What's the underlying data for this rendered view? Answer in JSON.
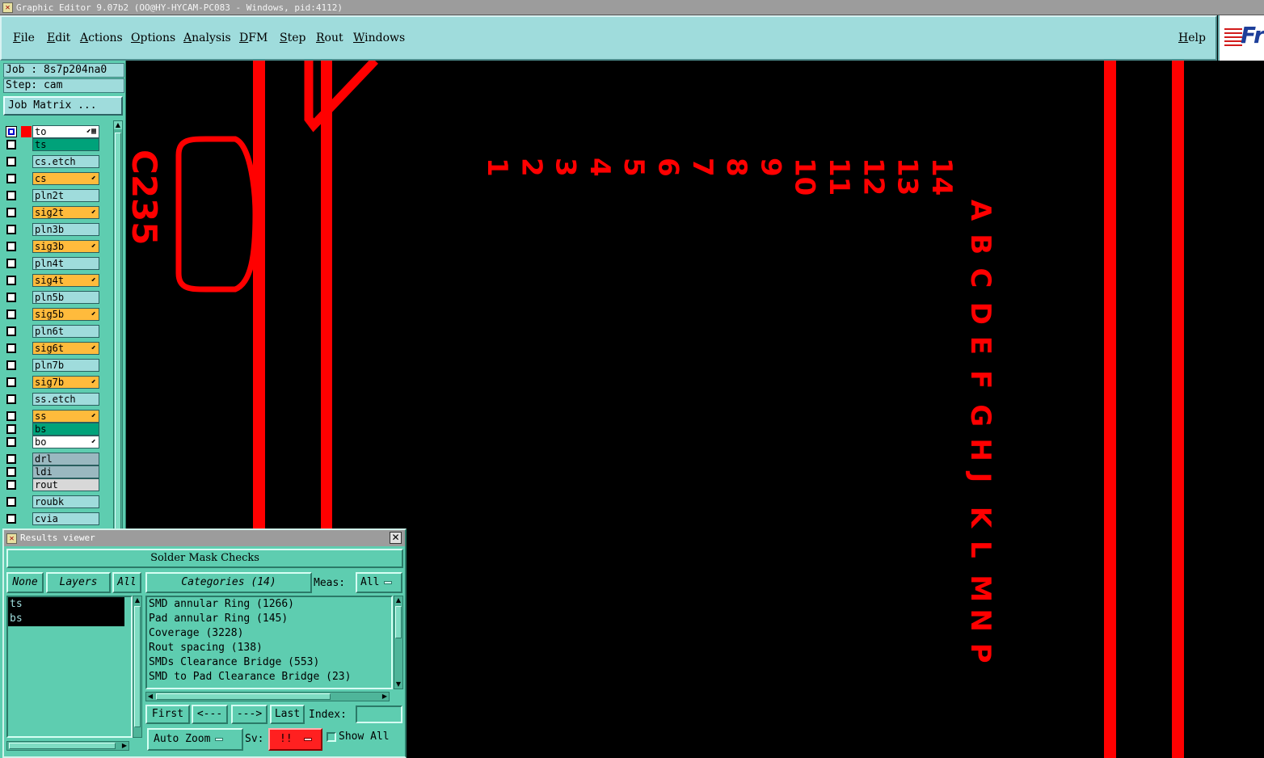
{
  "window": {
    "title": "Graphic Editor 9.07b2 (OO@HY-HYCAM-PC083 - Windows, pid:4112)"
  },
  "menu": {
    "items": [
      "File",
      "Edit",
      "Actions",
      "Options",
      "Analysis",
      "DFM",
      "Step",
      "Rout",
      "Windows"
    ],
    "help": "Help"
  },
  "logo": {
    "text": "Fr"
  },
  "job": {
    "job_line": "Job : 8s7p204na0",
    "step_line": "Step: cam",
    "job_matrix_label": "Job Matrix ..."
  },
  "layers": [
    {
      "name": "to",
      "bg": "#ffffff",
      "color": "#ff0000",
      "selected": true,
      "mark": "⬋▦"
    },
    {
      "name": "ts",
      "bg": "#00a27a",
      "color": "",
      "selected": false,
      "mark": ""
    },
    {
      "name": "cs.etch",
      "bg": "#9fdcdc",
      "color": "",
      "selected": false,
      "mark": ""
    },
    {
      "name": "cs",
      "bg": "#ffbb3c",
      "color": "",
      "selected": false,
      "mark": "⬋"
    },
    {
      "name": "pln2t",
      "bg": "#9fdcdc",
      "color": "",
      "selected": false,
      "mark": ""
    },
    {
      "name": "sig2t",
      "bg": "#ffbb3c",
      "color": "",
      "selected": false,
      "mark": "⬋"
    },
    {
      "name": "pln3b",
      "bg": "#9fdcdc",
      "color": "",
      "selected": false,
      "mark": ""
    },
    {
      "name": "sig3b",
      "bg": "#ffbb3c",
      "color": "",
      "selected": false,
      "mark": "⬋"
    },
    {
      "name": "pln4t",
      "bg": "#9fdcdc",
      "color": "",
      "selected": false,
      "mark": ""
    },
    {
      "name": "sig4t",
      "bg": "#ffbb3c",
      "color": "",
      "selected": false,
      "mark": "⬋"
    },
    {
      "name": "pln5b",
      "bg": "#9fdcdc",
      "color": "",
      "selected": false,
      "mark": ""
    },
    {
      "name": "sig5b",
      "bg": "#ffbb3c",
      "color": "",
      "selected": false,
      "mark": "⬋"
    },
    {
      "name": "pln6t",
      "bg": "#9fdcdc",
      "color": "",
      "selected": false,
      "mark": ""
    },
    {
      "name": "sig6t",
      "bg": "#ffbb3c",
      "color": "",
      "selected": false,
      "mark": "⬋"
    },
    {
      "name": "pln7b",
      "bg": "#9fdcdc",
      "color": "",
      "selected": false,
      "mark": ""
    },
    {
      "name": "sig7b",
      "bg": "#ffbb3c",
      "color": "",
      "selected": false,
      "mark": "⬋"
    },
    {
      "name": "ss.etch",
      "bg": "#9fdcdc",
      "color": "",
      "selected": false,
      "mark": ""
    },
    {
      "name": "ss",
      "bg": "#ffbb3c",
      "color": "",
      "selected": false,
      "mark": "⬋"
    },
    {
      "name": "bs",
      "bg": "#00a27a",
      "color": "",
      "selected": false,
      "mark": ""
    },
    {
      "name": "bo",
      "bg": "#ffffff",
      "color": "",
      "selected": false,
      "mark": "⬋"
    },
    {
      "name": "drl",
      "bg": "#9ab8c0",
      "color": "",
      "selected": false,
      "mark": ""
    },
    {
      "name": "ldi",
      "bg": "#9ab8c0",
      "color": "",
      "selected": false,
      "mark": ""
    },
    {
      "name": "rout",
      "bg": "#d8d8d8",
      "color": "",
      "selected": false,
      "mark": ""
    },
    {
      "name": "roubk",
      "bg": "#9fdcdc",
      "color": "",
      "selected": false,
      "mark": ""
    },
    {
      "name": "cvia",
      "bg": "#9fdcdc",
      "color": "",
      "selected": false,
      "mark": ""
    },
    {
      "name": "",
      "bg": "#9fdcdc",
      "color": "",
      "selected": false,
      "mark": ""
    }
  ],
  "canvas": {
    "trace_color": "#ff0000",
    "number_labels": [
      "1",
      "2",
      "3",
      "4",
      "5",
      "6",
      "7",
      "8",
      "9",
      "10",
      "11",
      "12",
      "13",
      "14"
    ],
    "letter_labels": [
      "A",
      "B",
      "C",
      "D",
      "E",
      "F",
      "G",
      "H",
      "J",
      "K",
      "L",
      "M",
      "N",
      "P"
    ],
    "ref_designator": "C235"
  },
  "results": {
    "title": "Results viewer",
    "close": "✕",
    "header": "Solder Mask Checks",
    "none_btn": "None",
    "layers_btn": "Layers",
    "all_btn": "All",
    "layer_list": [
      "ts",
      "bs"
    ],
    "categories_btn": "Categories (14)",
    "meas_label": "Meas:",
    "meas_value": "All",
    "categories": [
      "SMD annular Ring (1266)",
      "Pad annular Ring (145)",
      "Coverage (3228)",
      "Rout spacing (138)",
      "SMDs Clearance Bridge (553)",
      "SMD to Pad Clearance Bridge (23)"
    ],
    "first_btn": "First",
    "prev_btn": "<---",
    "next_btn": "--->",
    "last_btn": "Last",
    "index_label": "Index:",
    "index_value": "",
    "auto_zoom_label": "Auto Zoom",
    "sv_label": "Sv:",
    "sv_value": "!!",
    "show_all_label": "Show All"
  }
}
